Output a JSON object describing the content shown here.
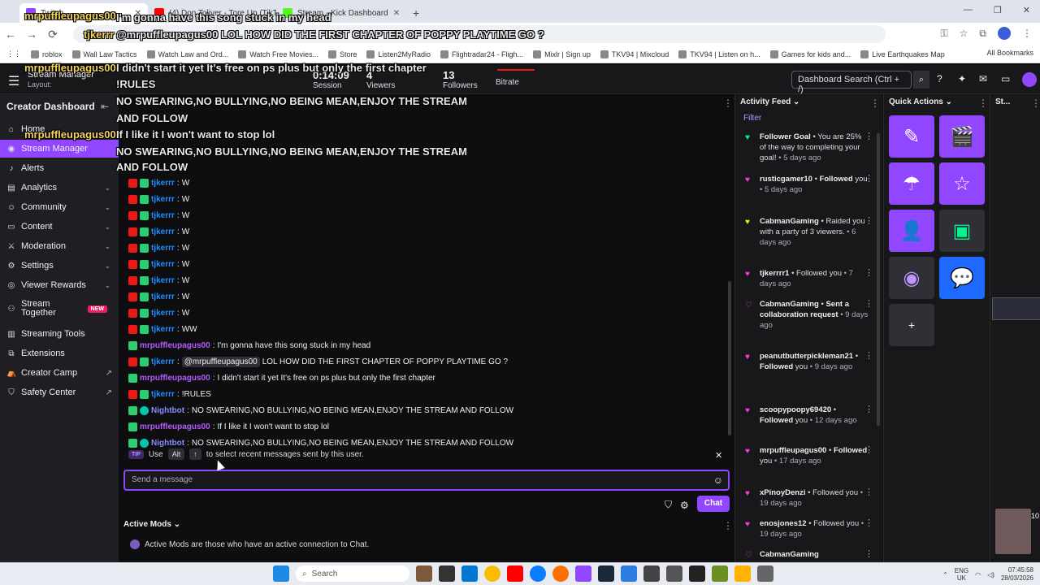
{
  "browser": {
    "tabs": [
      {
        "label": "Twitch",
        "color": "#9147ff",
        "active": true
      },
      {
        "label": "(4) Don Toliver - Tore Up (TikTo...",
        "color": "#ff0000",
        "active": false
      },
      {
        "label": "Stream - Kick Dashboard",
        "color": "#53fc18",
        "active": false
      }
    ],
    "new_tab": "+",
    "bookmarks": [
      "roblox",
      "Wall Law Tactics",
      "Watch Law and Ord...",
      "Watch Free Movies...",
      "Store",
      "Listen2MyRadio",
      "Flightradar24 - Fligh...",
      "Mixlr | Sign up",
      "TKV94 | Mixcloud",
      "TKV94 | Listen on h...",
      "Games for kids and...",
      "Live Earthquakes Map"
    ],
    "all_bookmarks": "All Bookmarks"
  },
  "topnav": {
    "title": "Stream Manager",
    "layout": "Layout:",
    "stats": [
      {
        "value": "0:14:09",
        "label": "Session"
      },
      {
        "value": "4",
        "label": "Viewers"
      },
      {
        "value": "13",
        "label": "Followers"
      },
      {
        "value": "",
        "label": "Bitrate"
      }
    ],
    "search_placeholder": "Dashboard Search (Ctrl + /)"
  },
  "sidebar": {
    "header": "Creator Dashboard",
    "items": [
      {
        "label": "Home",
        "icon": "home-icon",
        "chevron": false
      },
      {
        "label": "Stream Manager",
        "icon": "broadcast-icon",
        "active": true
      },
      {
        "label": "Alerts",
        "icon": "bell-icon"
      },
      {
        "label": "Analytics",
        "icon": "chart-icon",
        "chevron": true
      },
      {
        "label": "Community",
        "icon": "people-icon",
        "chevron": true
      },
      {
        "label": "Content",
        "icon": "content-icon",
        "chevron": true
      },
      {
        "label": "Moderation",
        "icon": "sword-icon",
        "chevron": true
      },
      {
        "label": "Settings",
        "icon": "gear-icon",
        "chevron": true
      },
      {
        "label": "Viewer Rewards",
        "icon": "reward-icon",
        "chevron": true
      },
      {
        "label": "Stream Together",
        "icon": "together-icon",
        "badge": "NEW"
      },
      {
        "label": "Streaming Tools",
        "icon": "tools-icon"
      },
      {
        "label": "Extensions",
        "icon": "extension-icon"
      },
      {
        "label": "Creator Camp",
        "icon": "camp-icon",
        "external": true
      },
      {
        "label": "Safety Center",
        "icon": "shield-icon",
        "external": true
      }
    ]
  },
  "chat": {
    "messages": [
      {
        "user": "tjkerrr",
        "text": "W",
        "badges": [
          "red",
          "green"
        ],
        "color": "blue"
      },
      {
        "user": "tjkerrr",
        "text": "W",
        "badges": [
          "red",
          "green"
        ],
        "color": "blue"
      },
      {
        "user": "tjkerrr",
        "text": "W",
        "badges": [
          "red",
          "green"
        ],
        "color": "blue"
      },
      {
        "user": "tjkerrr",
        "text": "W",
        "badges": [
          "red",
          "green"
        ],
        "color": "blue"
      },
      {
        "user": "tjkerrr",
        "text": "W",
        "badges": [
          "red",
          "green"
        ],
        "color": "blue"
      },
      {
        "user": "tjkerrr",
        "text": "W",
        "badges": [
          "red",
          "green"
        ],
        "color": "blue"
      },
      {
        "user": "tjkerrr",
        "text": "W",
        "badges": [
          "red",
          "green"
        ],
        "color": "blue"
      },
      {
        "user": "tjkerrr",
        "text": "W",
        "badges": [
          "red",
          "green"
        ],
        "color": "blue"
      },
      {
        "user": "tjkerrr",
        "text": "W",
        "badges": [
          "red",
          "green"
        ],
        "color": "blue"
      },
      {
        "user": "tjkerrr",
        "text": "WW",
        "badges": [
          "red",
          "green"
        ],
        "color": "blue"
      },
      {
        "user": "mrpuffleupagus00",
        "text": "I'm gonna have this song stuck in my head",
        "badges": [
          "green"
        ],
        "color": "purple"
      },
      {
        "user": "tjkerrr",
        "mention": "@mrpuffleupagus00",
        "text": "LOL HOW DID THE FIRST CHAPTER OF POPPY PLAYTIME GO ?",
        "badges": [
          "red",
          "green"
        ],
        "color": "blue"
      },
      {
        "user": "mrpuffleupagus00",
        "text": "I didn't start it yet It's free on ps plus but only the first chapter",
        "badges": [
          "green"
        ],
        "color": "purple"
      },
      {
        "user": "tjkerrr",
        "text": "!RULES",
        "badges": [
          "red",
          "green"
        ],
        "color": "blue"
      },
      {
        "user": "Nightbot",
        "text": "NO SWEARING,NO BULLYING,NO BEING MEAN,ENJOY THE STREAM AND FOLLOW",
        "badges": [
          "green",
          "bot"
        ],
        "color": "bot"
      },
      {
        "user": "mrpuffleupagus00",
        "text": "If I like it I won't want to stop lol",
        "badges": [
          "green"
        ],
        "color": "purple"
      },
      {
        "user": "Nightbot",
        "text": "NO SWEARING,NO BULLYING,NO BEING MEAN,ENJOY THE STREAM AND FOLLOW",
        "badges": [
          "green",
          "bot"
        ],
        "color": "bot"
      }
    ],
    "tip": {
      "tag": "TIP",
      "use": "Use",
      "key1": "Alt",
      "key2": "↑",
      "rest": "to select recent messages sent by this user."
    },
    "input_placeholder": "Send a message",
    "send_label": "Chat",
    "active_mods_title": "Active Mods",
    "active_mods_text": "Active Mods are those who have an active connection to Chat."
  },
  "activity": {
    "title": "Activity Feed",
    "filter": "Filter",
    "items": [
      {
        "icon": "goal-icon",
        "icon_color": "#00f593",
        "name": "Follower Goal",
        "rest": " • You are 25% of the way to completing your goal!",
        "when": " • 5 days ago"
      },
      {
        "icon": "heart-icon",
        "icon_color": "#ff38db",
        "name": "rusticgamer10",
        "act": "Followed",
        "rest": " you",
        "when": " • 5 days ago"
      },
      {
        "icon": "raid-icon",
        "icon_color": "#bfff00",
        "name": "CabmanGaming",
        "rest": " • Raided you with a party of 3 viewers.",
        "when": " • 6 days ago"
      },
      {
        "icon": "heart-icon",
        "icon_color": "#ff38db",
        "name": "tjkerrrr1",
        "act": "",
        "rest": " • Followed you",
        "when": " • 7 days ago"
      },
      {
        "icon": "collab-icon",
        "icon_color": "#ff38db",
        "name": "CabmanGaming",
        "act": "Sent a collaboration request",
        "rest": "",
        "when": " • 9 days ago"
      },
      {
        "icon": "heart-icon",
        "icon_color": "#ff38db",
        "name": "peanutbutterpickleman21",
        "act": "Followed",
        "rest": " you",
        "when": " • 9 days ago"
      },
      {
        "icon": "heart-icon",
        "icon_color": "#ff38db",
        "name": "scoopypoopy69420",
        "act": "Followed",
        "rest": " you",
        "when": " • 12 days ago"
      },
      {
        "icon": "heart-icon",
        "icon_color": "#ff38db",
        "name": "mrpuffleupagus00",
        "act": "Followed",
        "rest": " you",
        "when": " • 17 days ago"
      },
      {
        "icon": "heart-icon",
        "icon_color": "#ff38db",
        "name": "xPinoyDenzi",
        "act": "",
        "rest": " • Followed you",
        "when": " • 19 days ago"
      },
      {
        "icon": "heart-icon",
        "icon_color": "#ff38db",
        "name": "enosjones12",
        "act": "",
        "rest": " • Followed you",
        "when": " • 19 days ago"
      },
      {
        "icon": "collab-icon",
        "icon_color": "#ff38db",
        "name": "CabmanGaming",
        "act": "",
        "rest": "",
        "when": ""
      }
    ]
  },
  "quick_actions": {
    "title": "Quick Actions",
    "buttons": [
      "edit-icon",
      "clapper-icon",
      "parachute-icon",
      "star-icon",
      "add-user-icon",
      "extension-app-icon",
      "podcast-icon",
      "chat-bubble-icon",
      "plus-icon"
    ],
    "plus": "+"
  },
  "stcol": {
    "title": "St...",
    "cam_label": "10"
  },
  "overlay": [
    "mrpuffleupagus00",
    "I'm gonna have this song stuck in my head",
    "tjkerrr",
    "@mrpuffleupagus00 LOL HOW DID THE FIRST CHAPTER OF POPPY PLAYTIME GO ?",
    "mrpuffleupagus00",
    "I didn't start it yet It's free on ps plus but only the first chapter",
    "!RULES",
    "NO SWEARING,NO BULLYING,NO BEING MEAN,ENJOY THE STREAM",
    "AND FOLLOW",
    "mrpuffleupagus00",
    "If I like it I won't want to stop lol",
    "NO SWEARING,NO BULLYING,NO BEING MEAN,ENJOY THE STREAM",
    "AND FOLLOW"
  ],
  "taskbar": {
    "search": "Search",
    "lang1": "ENG",
    "lang2": "UK",
    "time": "07:45:58",
    "date": "28/03/2026"
  }
}
